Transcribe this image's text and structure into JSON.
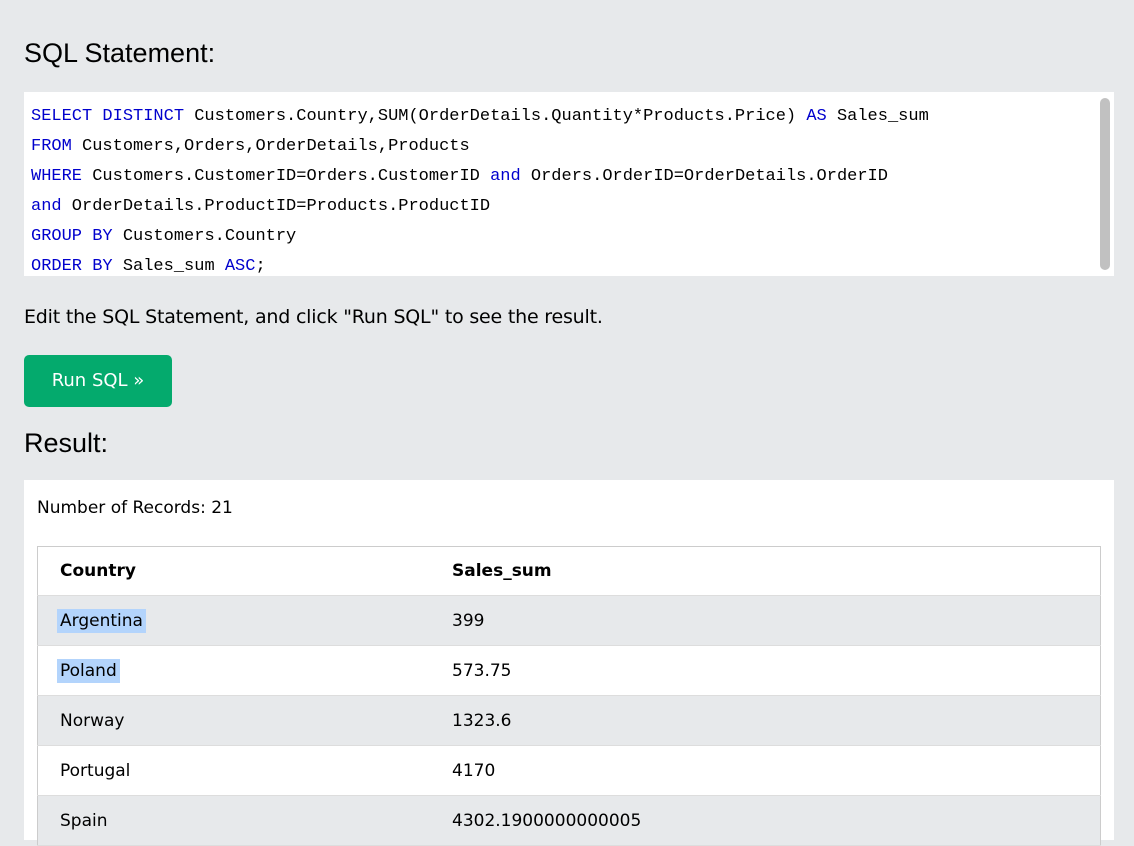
{
  "sql_section": {
    "title": "SQL Statement:",
    "lines": [
      [
        {
          "t": "SELECT DISTINCT",
          "k": true
        },
        {
          "t": " Customers.Country,SUM(OrderDetails.Quantity*Products.Price) ",
          "k": false
        },
        {
          "t": "AS",
          "k": true
        },
        {
          "t": " Sales_sum",
          "k": false
        }
      ],
      [
        {
          "t": "FROM",
          "k": true
        },
        {
          "t": " Customers,Orders,OrderDetails,Products",
          "k": false
        }
      ],
      [
        {
          "t": "WHERE",
          "k": true
        },
        {
          "t": " Customers.CustomerID=Orders.CustomerID ",
          "k": false
        },
        {
          "t": "and",
          "k": true
        },
        {
          "t": " Orders.OrderID=OrderDetails.OrderID",
          "k": false
        }
      ],
      [
        {
          "t": "and",
          "k": true
        },
        {
          "t": " OrderDetails.ProductID=Products.ProductID",
          "k": false
        }
      ],
      [
        {
          "t": "GROUP BY",
          "k": true
        },
        {
          "t": " Customers.Country",
          "k": false
        }
      ],
      [
        {
          "t": "ORDER BY",
          "k": true
        },
        {
          "t": " Sales_sum ",
          "k": false
        },
        {
          "t": "ASC",
          "k": true
        },
        {
          "t": ";",
          "k": false
        }
      ]
    ]
  },
  "hint": "Edit the SQL Statement, and click \"Run SQL\" to see the result.",
  "run_button": {
    "label": "Run SQL »"
  },
  "result_section": {
    "title": "Result:",
    "records_text": "Number of Records: 21",
    "columns": [
      "Country",
      "Sales_sum"
    ],
    "rows": [
      {
        "country": "Argentina",
        "sales_sum": "399",
        "selected": true
      },
      {
        "country": "Poland",
        "sales_sum": "573.75",
        "selected": true
      },
      {
        "country": "Norway",
        "sales_sum": "1323.6",
        "selected": false
      },
      {
        "country": "Portugal",
        "sales_sum": "4170",
        "selected": false
      },
      {
        "country": "Spain",
        "sales_sum": "4302.1900000000005",
        "selected": false
      }
    ]
  },
  "colors": {
    "keyword": "#0000cd",
    "button": "#04aa6d",
    "background": "#e7e9eb",
    "selection": "#b3d4fc"
  }
}
